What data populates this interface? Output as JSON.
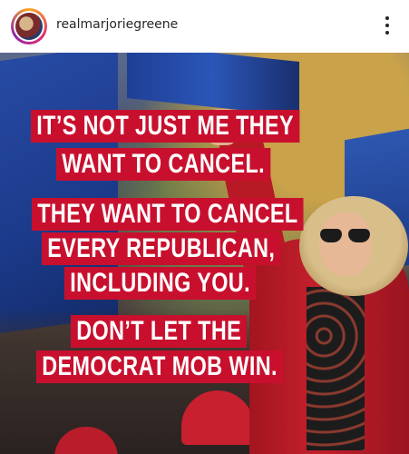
{
  "header": {
    "username": "realmarjoriegreene",
    "more_icon": "more-vertical-icon"
  },
  "post": {
    "lines": [
      "IT’S NOT JUST ME THEY",
      "WANT TO CANCEL.",
      "THEY WANT TO CANCEL",
      "EVERY REPUBLICAN,",
      "INCLUDING YOU.",
      "DON’T LET THE",
      "DEMOCRAT MOB WIN."
    ],
    "banner_color": "#C8102E",
    "text_color": "#FFFFFF"
  }
}
